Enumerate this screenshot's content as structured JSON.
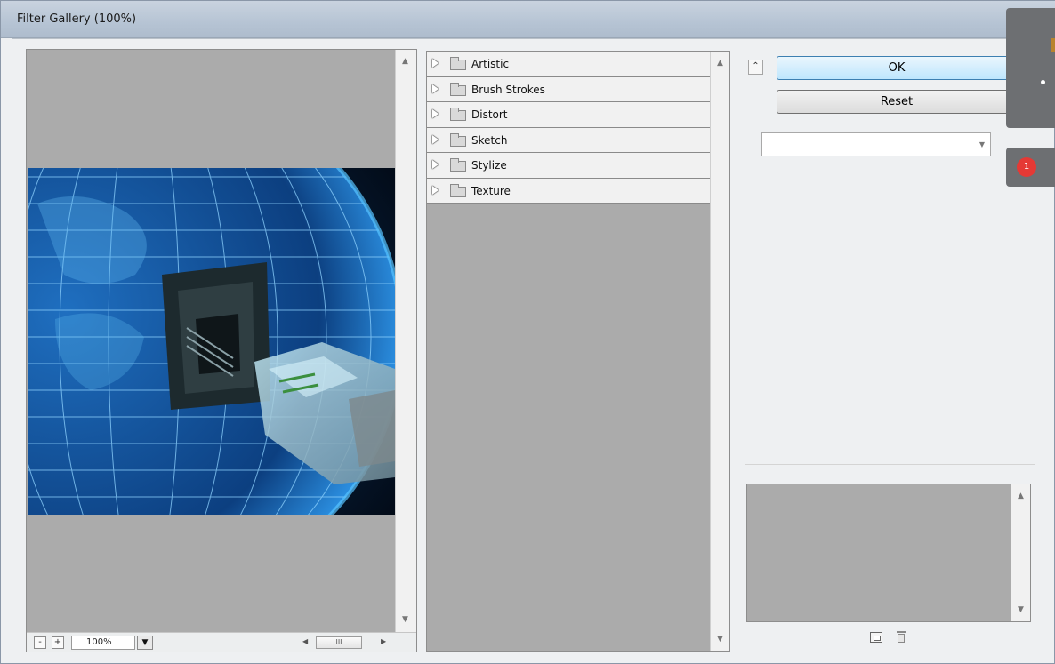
{
  "window": {
    "title": "Filter Gallery (100%)"
  },
  "preview": {
    "zoom_value": "100%",
    "zoom_minus": "-",
    "zoom_plus": "+",
    "hscroll_thumb": "III"
  },
  "filters": {
    "categories": [
      {
        "label": "Artistic"
      },
      {
        "label": "Brush Strokes"
      },
      {
        "label": "Distort"
      },
      {
        "label": "Sketch"
      },
      {
        "label": "Stylize"
      },
      {
        "label": "Texture"
      }
    ]
  },
  "actions": {
    "ok_label": "OK",
    "reset_label": "Reset"
  },
  "overlay": {
    "notification_count": "1"
  },
  "colors": {
    "ok_button": "#bee6fd",
    "panel_gray": "#ababab",
    "badge": "#e53935"
  }
}
